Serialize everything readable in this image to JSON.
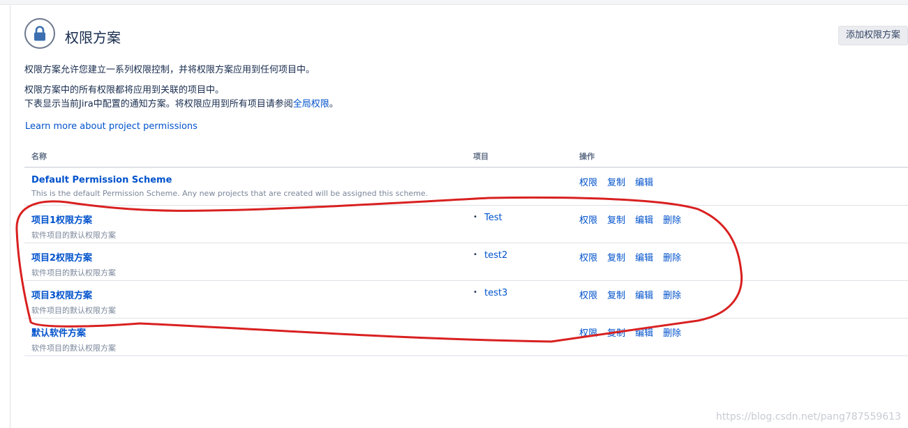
{
  "header": {
    "title": "权限方案",
    "add_button": "添加权限方案"
  },
  "intro": {
    "line1": "权限方案允许您建立一系列权限控制，并将权限方案应用到任何项目中。",
    "line2": "权限方案中的所有权限都将应用到关联的项目中。",
    "line3_prefix": "下表显示当前Jira中配置的通知方案。将权限应用到所有项目请参阅",
    "line3_link": "全局权限",
    "line3_suffix": "。",
    "learn_more": "Learn more about project permissions"
  },
  "table": {
    "headers": {
      "name": "名称",
      "projects": "项目",
      "actions": "操作"
    },
    "actions": {
      "permissions": "权限",
      "copy": "复制",
      "edit": "编辑",
      "delete": "删除"
    },
    "rows": [
      {
        "name": "Default Permission Scheme",
        "desc": "This is the default Permission Scheme. Any new projects that are created will be assigned this scheme.",
        "projects": [],
        "can_delete": false
      },
      {
        "name": "项目1权限方案",
        "desc": "软件项目的默认权限方案",
        "projects": [
          "Test"
        ],
        "can_delete": true
      },
      {
        "name": "项目2权限方案",
        "desc": "软件项目的默认权限方案",
        "projects": [
          "test2"
        ],
        "can_delete": true
      },
      {
        "name": "项目3权限方案",
        "desc": "软件项目的默认权限方案",
        "projects": [
          "test3"
        ],
        "can_delete": true
      },
      {
        "name": "默认软件方案",
        "desc": "软件项目的默认权限方案",
        "projects": [],
        "can_delete": true
      }
    ]
  },
  "watermark": "https://blog.csdn.net/pang787559613",
  "colors": {
    "link": "#0052cc",
    "annotation": "#d92020",
    "text": "#172b4d",
    "muted": "#7a869a"
  }
}
